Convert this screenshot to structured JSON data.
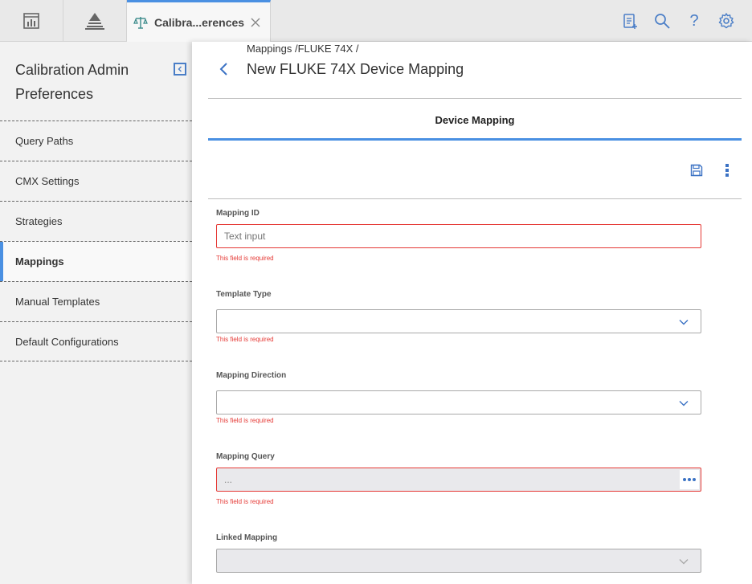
{
  "topbar": {
    "tab_label": "Calibra...erences",
    "icons": [
      "dashboard-icon",
      "pyramid-icon",
      "clipboard-add-icon",
      "search-icon",
      "help-icon",
      "gear-icon"
    ],
    "help_glyph": "?"
  },
  "sidebar": {
    "title": "Calibration Admin Preferences",
    "items": [
      {
        "label": "Query Paths"
      },
      {
        "label": "CMX Settings"
      },
      {
        "label": "Strategies"
      },
      {
        "label": "Mappings",
        "active": true
      },
      {
        "label": "Manual Templates"
      },
      {
        "label": "Default Configurations"
      }
    ]
  },
  "main": {
    "breadcrumb": "Mappings /FLUKE 74X /",
    "title": "New FLUKE 74X Device Mapping",
    "section_tab": "Device Mapping",
    "fields": {
      "mapping_id": {
        "label": "Mapping ID",
        "placeholder": "Text input",
        "error": "This field is required"
      },
      "template_type": {
        "label": "Template Type",
        "value": "",
        "error": "This field is required"
      },
      "mapping_direction": {
        "label": "Mapping Direction",
        "value": "",
        "error": "This field is required"
      },
      "mapping_query": {
        "label": "Mapping Query",
        "value": "...",
        "error": "This field is required"
      },
      "linked_mapping": {
        "label": "Linked Mapping",
        "value": ""
      }
    }
  },
  "colors": {
    "accent": "#4a90e2",
    "error": "#e53935",
    "icon_blue": "#3b72c4"
  }
}
